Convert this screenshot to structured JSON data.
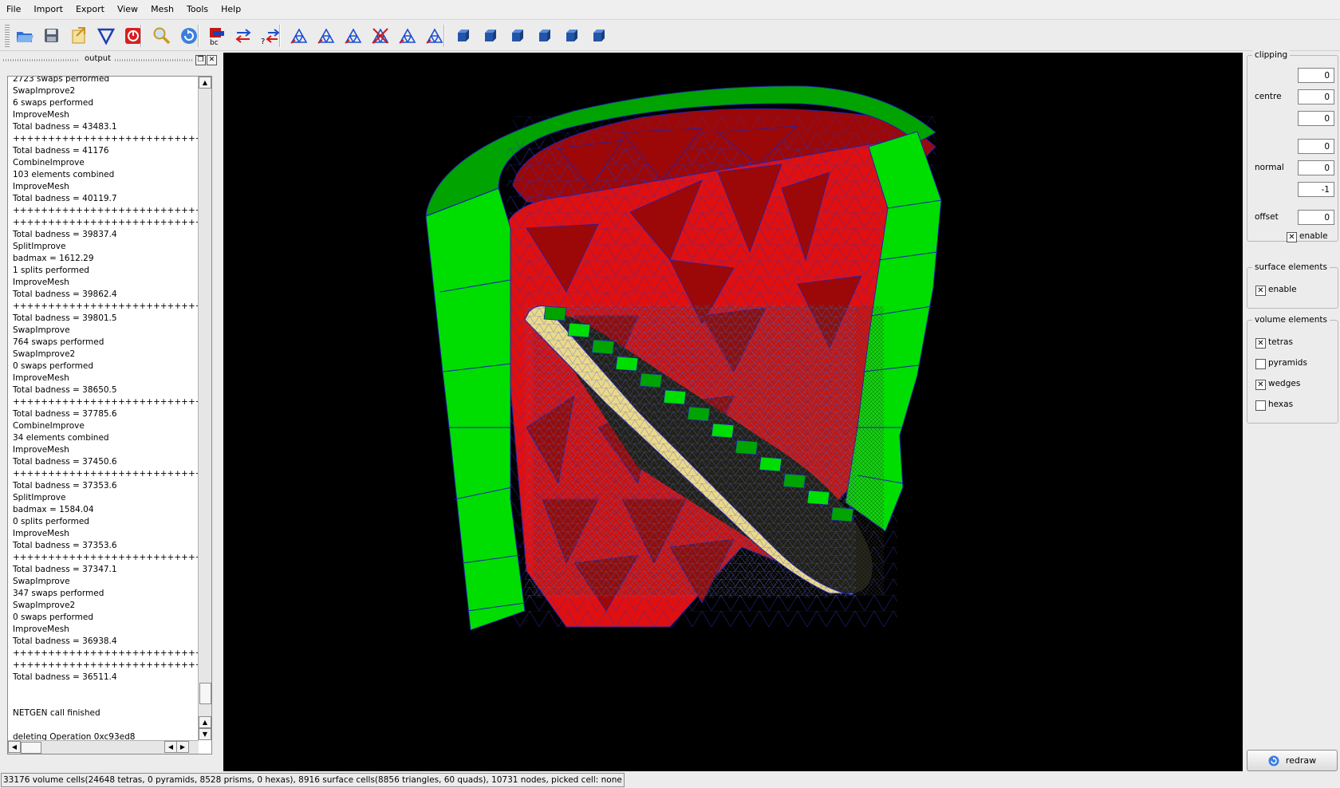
{
  "menu": [
    "File",
    "Import",
    "Export",
    "View",
    "Mesh",
    "Tools",
    "Help"
  ],
  "toolbar": {
    "buttons": [
      {
        "name": "open-icon",
        "color": "#2d6fd4"
      },
      {
        "name": "save-icon",
        "color": "#556070"
      },
      {
        "name": "export-icon",
        "color": "#c8901c"
      },
      {
        "name": "filter-icon",
        "color": "#1a3fb8"
      },
      {
        "name": "stop-icon",
        "color": "#d81e1e"
      },
      {
        "name": "zoom-icon",
        "color": "#c89b1e"
      },
      {
        "name": "refresh-icon",
        "color": "#3c7fe0"
      },
      {
        "name": "boundary-conditions-icon",
        "color": "#c01818"
      },
      {
        "name": "swap-arrows-icon",
        "color": "#1a4fd0"
      },
      {
        "name": "query-arrows-icon",
        "color": "#1a4fd0"
      },
      {
        "name": "mesh-tool-1-icon",
        "color": "#1a4fd0"
      },
      {
        "name": "mesh-tool-2-icon",
        "color": "#1a4fd0"
      },
      {
        "name": "mesh-tool-3-icon",
        "color": "#1a4fd0"
      },
      {
        "name": "mesh-delete-icon",
        "color": "#d01818"
      },
      {
        "name": "mesh-tool-5-icon",
        "color": "#1a4fd0"
      },
      {
        "name": "mesh-tool-6-icon",
        "color": "#1a4fd0"
      },
      {
        "name": "view-front-icon",
        "color": "#2255a8"
      },
      {
        "name": "view-back-icon",
        "color": "#2255a8"
      },
      {
        "name": "view-left-icon",
        "color": "#2255a8"
      },
      {
        "name": "view-right-icon",
        "color": "#2255a8"
      },
      {
        "name": "view-top-icon",
        "color": "#2255a8"
      },
      {
        "name": "view-bottom-icon",
        "color": "#2255a8"
      }
    ]
  },
  "output": {
    "title": "output",
    "lines": [
      "2723 swaps performed",
      "SwapImprove2",
      "6 swaps performed",
      "ImproveMesh",
      "Total badness = 43483.1",
      "++++++++++++++++++++++++++++++++++++",
      "Total badness = 41176",
      "CombineImprove",
      "103 elements combined",
      "ImproveMesh",
      "Total badness = 40119.7",
      "++++++++++++++++++++++++++++++++++++",
      "++++++++++++++++++++++++++++++++++++",
      "Total badness = 39837.4",
      "SplitImprove",
      "badmax = 1612.29",
      "1 splits performed",
      "ImproveMesh",
      "Total badness = 39862.4",
      "++++++++++++++++++++++++++++++++++++",
      "Total badness = 39801.5",
      "SwapImprove",
      "764 swaps performed",
      "SwapImprove2",
      "0 swaps performed",
      "ImproveMesh",
      "Total badness = 38650.5",
      "++++++++++++++++++++++++++++++++++++",
      "Total badness = 37785.6",
      "CombineImprove",
      "34 elements combined",
      "ImproveMesh",
      "Total badness = 37450.6",
      "++++++++++++++++++++++++++++++++++++",
      "Total badness = 37353.6",
      "SplitImprove",
      "badmax = 1584.04",
      "0 splits performed",
      "ImproveMesh",
      "Total badness = 37353.6",
      "++++++++++++++++++++++++++++++++++++",
      "Total badness = 37347.1",
      "SwapImprove",
      "347 swaps performed",
      "SwapImprove2",
      "0 swaps performed",
      "ImproveMesh",
      "Total badness = 36938.4",
      "++++++++++++++++++++++++++++++++++++",
      "++++++++++++++++++++++++++++++++++++",
      "Total badness = 36511.4",
      "",
      "",
      "NETGEN call finished",
      "",
      "deleting Operation 0xc93ed8"
    ]
  },
  "clipping": {
    "title": "clipping",
    "centre_label": "centre",
    "centre": [
      "0",
      "0",
      "0"
    ],
    "normal_label": "normal",
    "normal": [
      "0",
      "0",
      "-1"
    ],
    "offset_label": "offset",
    "offset": "0",
    "enable_label": "enable",
    "enable_checked": true
  },
  "surface_elements": {
    "title": "surface elements",
    "enable_label": "enable",
    "enable_checked": true
  },
  "volume_elements": {
    "title": "volume elements",
    "items": [
      {
        "label": "tetras",
        "checked": true
      },
      {
        "label": "pyramids",
        "checked": false
      },
      {
        "label": "wedges",
        "checked": true
      },
      {
        "label": "hexas",
        "checked": false
      }
    ]
  },
  "redraw_label": "redraw",
  "status": "33176 volume cells(24648 tetras, 0 pyramids, 8528 prisms, 0 hexas), 8916 surface cells(8856 triangles, 60 quads), 10731 nodes, picked cell: none",
  "colors": {
    "background": "#000000",
    "tetra_red": "#e01010",
    "tetra_dark_red": "#9c0808",
    "wedge_green": "#00dd00",
    "wedge_dark_green": "#00a300",
    "blade_yellow": "#ead98a",
    "blade_dark": "#1e1e16",
    "edge_blue": "#2020b0"
  }
}
